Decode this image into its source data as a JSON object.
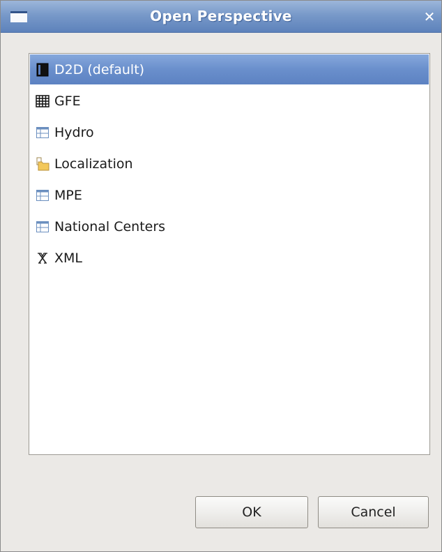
{
  "window": {
    "title": "Open Perspective",
    "close_glyph": "✕"
  },
  "perspectives": [
    {
      "label": "D2D (default)",
      "icon": "d2d-icon",
      "selected": true
    },
    {
      "label": "GFE",
      "icon": "grid-icon",
      "selected": false
    },
    {
      "label": "Hydro",
      "icon": "window-icon",
      "selected": false
    },
    {
      "label": "Localization",
      "icon": "folder-icon",
      "selected": false
    },
    {
      "label": "MPE",
      "icon": "window-icon",
      "selected": false
    },
    {
      "label": "National Centers",
      "icon": "window-icon",
      "selected": false
    },
    {
      "label": "XML",
      "icon": "xml-icon",
      "selected": false
    }
  ],
  "buttons": {
    "ok_label": "OK",
    "cancel_label": "Cancel"
  },
  "colors": {
    "titlebar": "#7899c9",
    "selection": "#6a8fcc"
  }
}
